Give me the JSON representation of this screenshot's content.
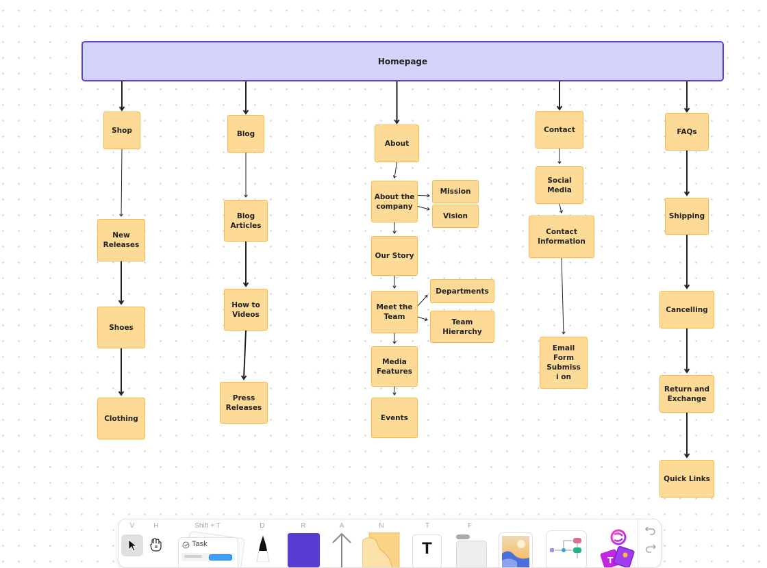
{
  "diagram": {
    "root": {
      "id": "homepage",
      "label": "Homepage",
      "fill": "#d4d4fa",
      "stroke": "#5b43d6"
    },
    "node_style": {
      "fill": "#fddb96",
      "stroke": "#f7b84a"
    },
    "edge_color": "#222222",
    "columns": [
      {
        "id": "shop",
        "label": "Shop",
        "children": [
          {
            "id": "new-releases",
            "label": "New Releases"
          },
          {
            "id": "shoes",
            "label": "Shoes"
          },
          {
            "id": "clothing",
            "label": "Clothing"
          }
        ]
      },
      {
        "id": "blog",
        "label": "Blog",
        "children": [
          {
            "id": "blog-articles",
            "label": "Blog Articles"
          },
          {
            "id": "how-to-videos",
            "label": "How to Videos"
          },
          {
            "id": "press-releases",
            "label": "Press Releases"
          }
        ]
      },
      {
        "id": "about",
        "label": "About",
        "children": [
          {
            "id": "about-the-company",
            "label": "About the company",
            "branches": [
              {
                "id": "mission",
                "label": "Mission"
              },
              {
                "id": "vision",
                "label": "Vision"
              }
            ]
          },
          {
            "id": "our-story",
            "label": "Our Story"
          },
          {
            "id": "meet-the-team",
            "label": "Meet the Team",
            "branches": [
              {
                "id": "departments",
                "label": "Departments"
              },
              {
                "id": "team-hierarchy",
                "label": "Team Hierarchy"
              }
            ]
          },
          {
            "id": "media-features",
            "label": "Media Features"
          },
          {
            "id": "events",
            "label": "Events"
          }
        ]
      },
      {
        "id": "contact",
        "label": "Contact",
        "children": [
          {
            "id": "social-media",
            "label": "Social Media"
          },
          {
            "id": "contact-information",
            "label": "Contact Information"
          },
          {
            "id": "email-form-submission",
            "label": "Email Form Submissi on"
          }
        ]
      },
      {
        "id": "faqs",
        "label": "FAQs",
        "children": [
          {
            "id": "shipping",
            "label": "Shipping"
          },
          {
            "id": "cancelling",
            "label": "Cancelling"
          },
          {
            "id": "return-and-exchange",
            "label": "Return and Exchange"
          },
          {
            "id": "quick-links",
            "label": "Quick Links"
          }
        ]
      }
    ]
  },
  "toolbar": {
    "tools": [
      {
        "key": "V",
        "name": "select-tool",
        "icon": "cursor-icon",
        "selected": true
      },
      {
        "key": "H",
        "name": "hand-tool",
        "icon": "hand-icon"
      },
      {
        "key": "Shift + T",
        "name": "task-tool",
        "icon": "task-card-icon",
        "label": "Task"
      },
      {
        "key": "D",
        "name": "pen-tool",
        "icon": "pen-icon"
      },
      {
        "key": "R",
        "name": "shape-tool",
        "icon": "rectangle-icon",
        "color": "#5a3bd1"
      },
      {
        "key": "A",
        "name": "arrow-tool",
        "icon": "arrow-up-icon"
      },
      {
        "key": "N",
        "name": "sticky-note-tool",
        "icon": "sticky-note-icon",
        "color": "#fad386"
      },
      {
        "key": "T",
        "name": "text-tool",
        "icon": "text-icon",
        "label": "T"
      },
      {
        "key": "F",
        "name": "frame-tool",
        "icon": "frame-icon"
      },
      {
        "key": "",
        "name": "image-tool",
        "icon": "image-icon"
      },
      {
        "key": "",
        "name": "flowchart-tool",
        "icon": "flowchart-icon"
      },
      {
        "key": "",
        "name": "ai-tool",
        "icon": "ai-sparkle-icon"
      }
    ],
    "undo": "undo-icon",
    "redo": "redo-icon"
  }
}
